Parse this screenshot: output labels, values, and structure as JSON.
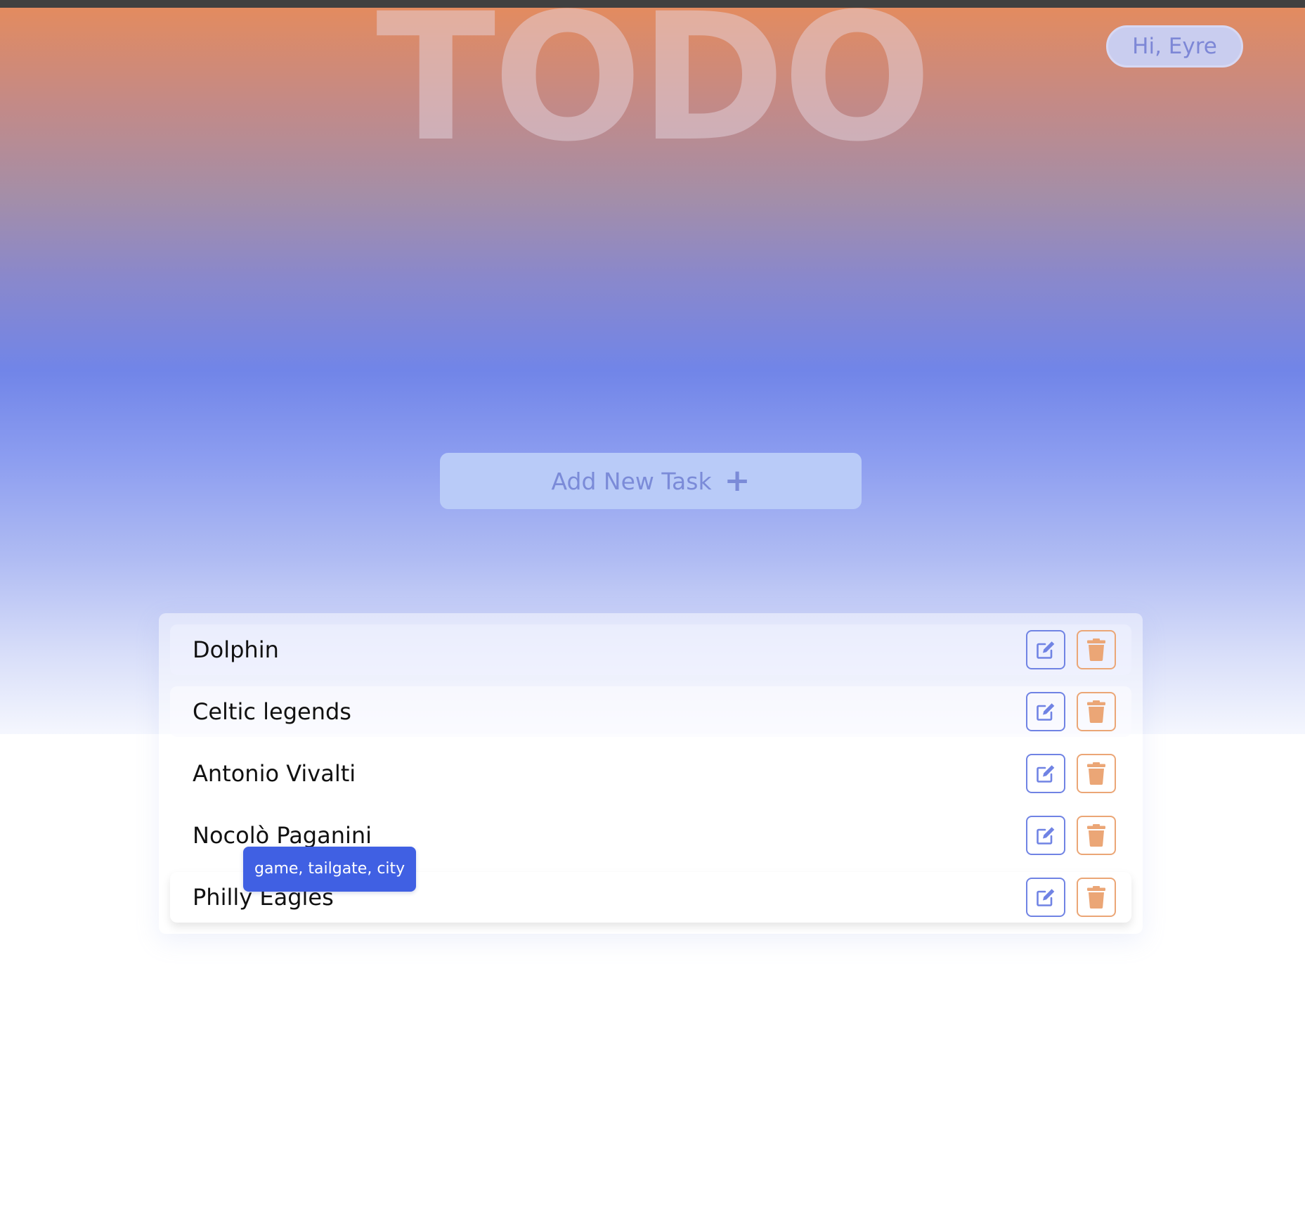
{
  "header": {
    "logo_text": "TODO",
    "greeting": "Hi, Eyre"
  },
  "actions": {
    "add_task_label": "Add New Task",
    "add_task_icon": "plus-icon"
  },
  "tasks": [
    {
      "title": "Dolphin"
    },
    {
      "title": "Celtic legends"
    },
    {
      "title": "Antonio Vivalti"
    },
    {
      "title": "Nocolò Paganini"
    },
    {
      "title": "Philly Eagles"
    }
  ],
  "tooltip": {
    "text": "game, tailgate, city"
  },
  "icons": {
    "edit": "edit-icon",
    "delete": "trash-icon"
  },
  "colors": {
    "accent_blue": "#7083e4",
    "accent_orange": "#eba676",
    "tooltip_bg": "#4060e3"
  }
}
